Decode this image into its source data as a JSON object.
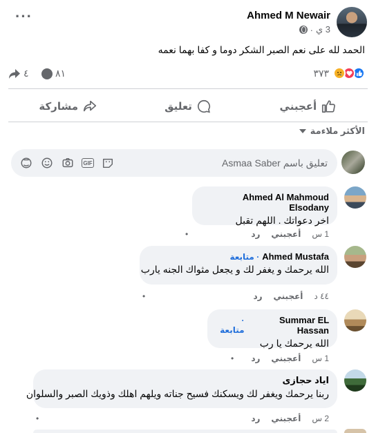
{
  "post": {
    "author": "Ahmed M Newair",
    "time": "3 ي",
    "text": "الحمد لله على نعم الصبر الشكر دوما و كفا بهما نعمه",
    "reaction_count": "٣٧٣",
    "comment_count": "٨١",
    "share_count": "٤"
  },
  "actions": {
    "like": "أعجبني",
    "comment": "تعليق",
    "share": "مشاركة"
  },
  "sort": {
    "label": "الأكثر ملاءمة"
  },
  "composer": {
    "placeholder": "تعليق باسم Asmaa Saber"
  },
  "comments": [
    {
      "name": "Ahmed Al Mahmoud Elsodany",
      "follow": "",
      "text": "اخر دعواتك . اللهم تقبل",
      "time": "1 س",
      "like": "أعجبني",
      "reply": "رد"
    },
    {
      "name": "Ahmed Mustafa",
      "follow": "· متابعة",
      "text": "الله يرحمك و يغفر لك و يجعل مثواك الجنه يارب",
      "time": "٤٤ د",
      "like": "أعجبني",
      "reply": "رد"
    },
    {
      "name": "Summar EL Hassan",
      "follow": "· متابعة",
      "text": "الله يرحمك يا رب",
      "time": "1 س",
      "like": "أعجبني",
      "reply": "رد"
    },
    {
      "name": "اياد حجازى",
      "follow": "",
      "text": "ربنا يرحمك ويغفر لك ويسكنك فسيح جناته ويلهم اهلك وذويك الصبر والسلوان",
      "time": "2 س",
      "like": "أعجبني",
      "reply": "رد"
    }
  ],
  "colors": {
    "like_blue": "#1877f2",
    "love_red": "#f33e58",
    "sad_yellow": "#f7b125",
    "follow_blue": "#216fdb"
  }
}
